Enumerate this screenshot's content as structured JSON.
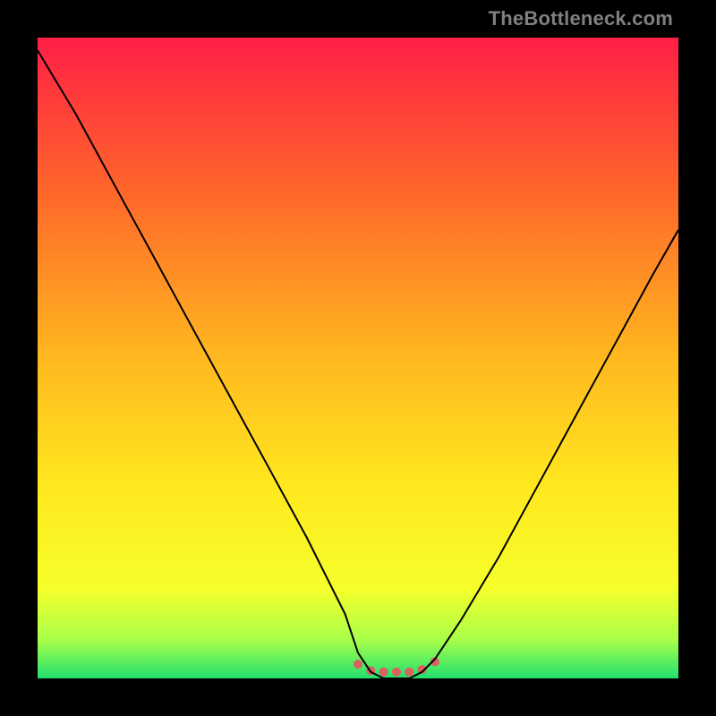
{
  "watermark": "TheBottleneck.com",
  "chart_data": {
    "type": "line",
    "title": "",
    "xlabel": "",
    "ylabel": "",
    "xlim": [
      0,
      100
    ],
    "ylim": [
      0,
      100
    ],
    "series": [
      {
        "name": "vcurve",
        "x": [
          0,
          6,
          12,
          18,
          24,
          30,
          36,
          42,
          48,
          50,
          52,
          54,
          56,
          58,
          60,
          62,
          66,
          72,
          78,
          84,
          90,
          96,
          100
        ],
        "values": [
          98,
          88,
          77,
          66,
          55,
          44,
          33,
          22,
          10,
          4,
          1,
          0,
          0,
          0,
          1,
          3,
          9,
          19,
          30,
          41,
          52,
          63,
          70
        ]
      }
    ],
    "bottom_marks": {
      "name": "dots",
      "x": [
        50,
        52,
        54,
        56,
        58,
        60,
        62
      ],
      "values": [
        2.2,
        1.2,
        1.0,
        1.0,
        1.0,
        1.4,
        2.6
      ]
    },
    "gradient_stops": [
      {
        "offset": 0.0,
        "color": "#ff1f46"
      },
      {
        "offset": 0.25,
        "color": "#ff6a2a"
      },
      {
        "offset": 0.5,
        "color": "#ffb81f"
      },
      {
        "offset": 0.7,
        "color": "#ffe81f"
      },
      {
        "offset": 0.86,
        "color": "#f6ff2a"
      },
      {
        "offset": 0.94,
        "color": "#a8ff4a"
      },
      {
        "offset": 1.0,
        "color": "#22e06e"
      }
    ],
    "dot_color": "#d9615f",
    "line_color": "#000000"
  }
}
